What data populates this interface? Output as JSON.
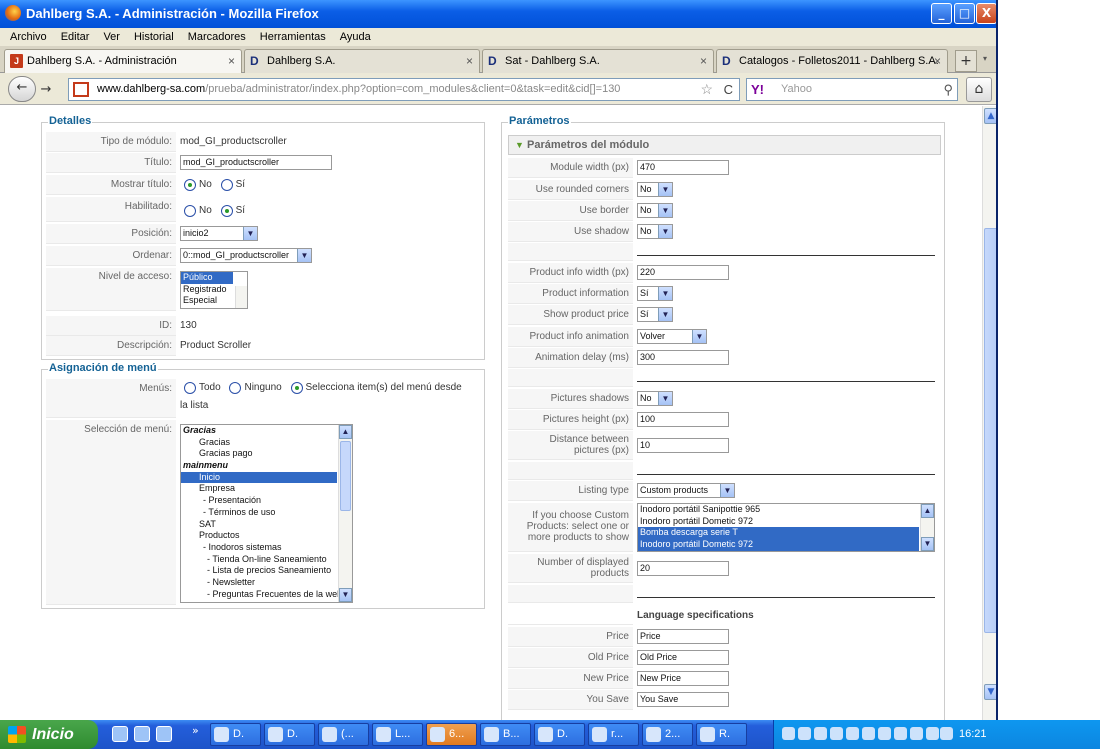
{
  "window": {
    "title": "Dahlberg S.A. - Administración - Mozilla Firefox",
    "buttons": {
      "minimize": "_",
      "maximize": "□",
      "close": "X"
    }
  },
  "menu": [
    "Archivo",
    "Editar",
    "Ver",
    "Historial",
    "Marcadores",
    "Herramientas",
    "Ayuda"
  ],
  "tabs": [
    {
      "label": "Dahlberg S.A. - Administración",
      "icon": "joomla-icon",
      "active": true
    },
    {
      "label": "Dahlberg S.A.",
      "icon": "D",
      "active": false
    },
    {
      "label": "Sat - Dahlberg S.A.",
      "icon": "D",
      "active": false
    },
    {
      "label": "Catalogos - Folletos2011 - Dahlberg S.A.",
      "icon": "D",
      "active": false
    }
  ],
  "tab_close": "×",
  "new_tab": "+",
  "nav": {
    "url_domain": "www.dahlberg-sa.com",
    "url_path": "/prueba/administrator/index.php?option=com_modules&client=0&task=edit&cid[]=130",
    "search_placeholder": "Yahoo",
    "back": "←",
    "forward": "→",
    "home": "⌂",
    "star": "☆",
    "reload": "C",
    "search_engine": "Y!",
    "search": "⚲"
  },
  "detalles": {
    "legend": "Detalles",
    "tipo": {
      "label": "Tipo de módulo:",
      "value": "mod_GI_productscroller"
    },
    "titulo": {
      "label": "Título:",
      "value": "mod_GI_productscroller"
    },
    "mostrar": {
      "label": "Mostrar título:",
      "no": "No",
      "si": "Sí",
      "selected": "no"
    },
    "habilitado": {
      "label": "Habilitado:",
      "no": "No",
      "si": "Sí",
      "selected": "si"
    },
    "posicion": {
      "label": "Posición:",
      "value": "inicio2"
    },
    "ordenar": {
      "label": "Ordenar:",
      "value": "0::mod_GI_productscroller"
    },
    "nivel": {
      "label": "Nivel de acceso:",
      "options": [
        "Público",
        "Registrado",
        "Especial"
      ],
      "selected": 0
    },
    "id": {
      "label": "ID:",
      "value": "130"
    },
    "descripcion": {
      "label": "Descripción:",
      "value": "Product Scroller"
    }
  },
  "asignacion": {
    "legend": "Asignación de menú",
    "menus": {
      "label": "Menús:",
      "todo": "Todo",
      "ninguno": "Ninguno",
      "selecciona": "Selecciona item(s) del menú desde",
      "selecciona2": "la lista",
      "selected": "selecciona"
    },
    "seleccion_label": "Selección de menú:",
    "items": [
      {
        "text": "Gracias",
        "heading": true
      },
      {
        "text": "Gracias",
        "indent": 1
      },
      {
        "text": "Gracias pago",
        "indent": 1
      },
      {
        "text": "mainmenu",
        "heading": true
      },
      {
        "text": "Inicio",
        "indent": 1,
        "selected": true
      },
      {
        "text": "Empresa",
        "indent": 1
      },
      {
        "text": "- Presentación",
        "indent": 2
      },
      {
        "text": "- Términos de uso",
        "indent": 2
      },
      {
        "text": "SAT",
        "indent": 1
      },
      {
        "text": "Productos",
        "indent": 1
      },
      {
        "text": "- Inodoros sistemas",
        "indent": 2
      },
      {
        "text": "- Tienda On-line Saneamiento",
        "indent": 3
      },
      {
        "text": "- Lista de precios Saneamiento",
        "indent": 3
      },
      {
        "text": "- Newsletter",
        "indent": 3
      },
      {
        "text": "- Preguntas Frecuentes de la web",
        "indent": 3
      }
    ]
  },
  "parametros": {
    "legend": "Parámetros",
    "panel_title": "Parámetros del módulo",
    "module_width": {
      "label": "Module width (px)",
      "value": "470"
    },
    "rounded": {
      "label": "Use rounded corners",
      "value": "No"
    },
    "border": {
      "label": "Use border",
      "value": "No"
    },
    "shadow": {
      "label": "Use shadow",
      "value": "No"
    },
    "info_width": {
      "label": "Product info width (px)",
      "value": "220"
    },
    "info": {
      "label": "Product information",
      "value": "Sí"
    },
    "price": {
      "label": "Show product price",
      "value": "Sí"
    },
    "animation": {
      "label": "Product info animation",
      "value": "Volver"
    },
    "delay": {
      "label": "Animation delay (ms)",
      "value": "300"
    },
    "pic_shadows": {
      "label": "Pictures shadows",
      "value": "No"
    },
    "pic_height": {
      "label": "Pictures height (px)",
      "value": "100"
    },
    "distance": {
      "label1": "Distance between",
      "label2": "pictures (px)",
      "value": "10"
    },
    "listing": {
      "label": "Listing type",
      "value": "Custom products"
    },
    "custom": {
      "label1": "If you choose Custom",
      "label2": "Products: select one or",
      "label3": "more products to show",
      "items": [
        {
          "text": "Inodoro portátil Sanipottie 965",
          "selected": false
        },
        {
          "text": "Inodoro portátil Dometic 972",
          "selected": false
        },
        {
          "text": "Bomba descarga serie T",
          "selected": true
        },
        {
          "text": "Inodoro portátil Dometic 972",
          "selected": true
        }
      ]
    },
    "displayed": {
      "label1": "Number of displayed",
      "label2": "products",
      "value": "20"
    },
    "lang_title": "Language specifications",
    "price_lbl": {
      "label": "Price",
      "value": "Price"
    },
    "old_price": {
      "label": "Old Price",
      "value": "Old Price"
    },
    "new_price": {
      "label": "New Price",
      "value": "New Price"
    },
    "you_save": {
      "label": "You Save",
      "value": "You Save"
    }
  },
  "taskbar": {
    "start": "Inicio",
    "chevron": "»",
    "items": [
      {
        "label": "D.",
        "active": false
      },
      {
        "label": "D.",
        "active": false
      },
      {
        "label": "(...",
        "active": false
      },
      {
        "label": "L...",
        "active": false
      },
      {
        "label": "6...",
        "active": true
      },
      {
        "label": "B...",
        "active": false
      },
      {
        "label": "D.",
        "active": false
      },
      {
        "label": "r...",
        "active": false
      },
      {
        "label": "2...",
        "active": false
      },
      {
        "label": "R.",
        "active": false
      }
    ],
    "clock": "16:21"
  }
}
